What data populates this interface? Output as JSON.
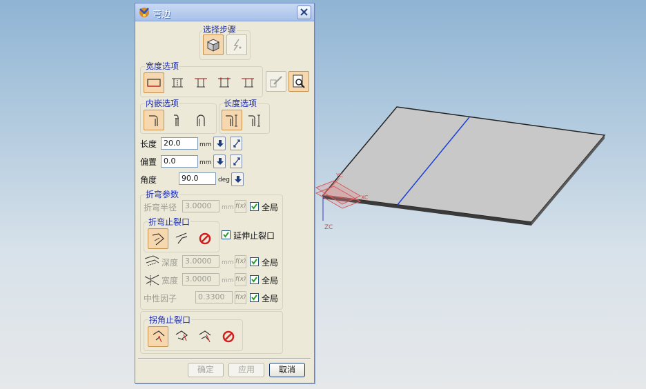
{
  "window": {
    "title": "弯边"
  },
  "steps": {
    "label": "选择步骤"
  },
  "width_options": {
    "label": "宽度选项"
  },
  "inset_options": {
    "label": "内嵌选项"
  },
  "length_options": {
    "label": "长度选项"
  },
  "fields": {
    "length": {
      "label": "长度",
      "value": "20.0",
      "unit": "mm"
    },
    "offset": {
      "label": "偏置",
      "value": "0.0",
      "unit": "mm"
    },
    "angle": {
      "label": "角度",
      "value": "90.0",
      "unit": "deg"
    }
  },
  "bend_params": {
    "label": "折弯参数",
    "radius": {
      "label": "折弯半径",
      "value": "3.0000",
      "unit": "mm",
      "fx": "f(x)",
      "global_label": "全局",
      "global_checked": true
    }
  },
  "bend_relief": {
    "label": "折弯止裂口",
    "extend_label": "延伸止裂口",
    "extend_checked": true,
    "depth": {
      "label": "深度",
      "value": "3.0000",
      "unit": "mm",
      "fx": "f(x)",
      "global_label": "全局",
      "global_checked": true
    },
    "width": {
      "label": "宽度",
      "value": "3.0000",
      "unit": "mm",
      "fx": "f(x)",
      "global_label": "全局",
      "global_checked": true
    }
  },
  "neutral_factor": {
    "label": "中性因子",
    "value": "0.3300",
    "fx": "f(x)",
    "global_label": "全局",
    "global_checked": true
  },
  "corner_relief": {
    "label": "拐角止裂口"
  },
  "buttons": {
    "ok": "确定",
    "apply": "应用",
    "cancel": "取消"
  },
  "viewport": {
    "axis_labels": {
      "xc": "XC",
      "yc": "YC",
      "zc": "ZC"
    }
  },
  "colors": {
    "selected_button": "#f7d7ae",
    "group_label": "#1a2bb0",
    "axis": "#d45a5a",
    "bend_line": "#1a3fd6"
  }
}
